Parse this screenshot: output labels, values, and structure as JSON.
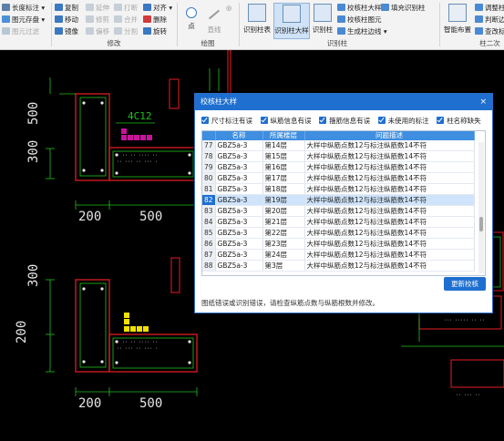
{
  "ribbon": {
    "col1": [
      "长度标注",
      "图元存盘",
      "图元过滤"
    ],
    "col2": [
      "复制",
      "移动",
      "镜像"
    ],
    "col3": [
      "延伸",
      "修剪",
      "偏移"
    ],
    "col4": [
      "打断",
      "合并",
      "分割"
    ],
    "col5": [
      "对齐",
      "删除",
      "旋转"
    ],
    "modify_group": "修改",
    "draw_items": [
      "点",
      "直线"
    ],
    "draw_group": "绘图",
    "recog_buttons": [
      "识别柱表",
      "识别柱大样",
      "识别柱"
    ],
    "recog_small": [
      "校核柱大样",
      "校核柱图元",
      "生成柱边线"
    ],
    "fill_label": "填充识别柱",
    "recog_group": "识别柱",
    "smart_layout": "智能布置",
    "right_items": [
      "调整柱",
      "判断边",
      "查改标"
    ],
    "right_group": "柱二次"
  },
  "canvas": {
    "dims": [
      "200",
      "500",
      "300",
      "200",
      "500",
      "300",
      "200",
      "500"
    ],
    "rebar_label": "4C12"
  },
  "dialog": {
    "title": "校核柱大样",
    "close": "×",
    "filters": [
      "尺寸标注有误",
      "纵筋信息有误",
      "箍筋信息有误",
      "未使用的标注",
      "柱名称缺失"
    ],
    "columns": [
      "",
      "名称",
      "所属楼层",
      "问题描述"
    ],
    "rows": [
      {
        "no": "77",
        "name": "GBZ5a-3",
        "floor": "第14层",
        "desc": "大样中纵筋点数12与标注纵筋数14不符"
      },
      {
        "no": "78",
        "name": "GBZ5a-3",
        "floor": "第15层",
        "desc": "大样中纵筋点数12与标注纵筋数14不符"
      },
      {
        "no": "79",
        "name": "GBZ5a-3",
        "floor": "第16层",
        "desc": "大样中纵筋点数12与标注纵筋数14不符"
      },
      {
        "no": "80",
        "name": "GBZ5a-3",
        "floor": "第17层",
        "desc": "大样中纵筋点数12与标注纵筋数14不符"
      },
      {
        "no": "81",
        "name": "GBZ5a-3",
        "floor": "第18层",
        "desc": "大样中纵筋点数12与标注纵筋数14不符"
      },
      {
        "no": "82",
        "name": "GBZ5a-3",
        "floor": "第19层",
        "desc": "大样中纵筋点数12与标注纵筋数14不符"
      },
      {
        "no": "83",
        "name": "GBZ5a-3",
        "floor": "第20层",
        "desc": "大样中纵筋点数12与标注纵筋数14不符"
      },
      {
        "no": "84",
        "name": "GBZ5a-3",
        "floor": "第21层",
        "desc": "大样中纵筋点数12与标注纵筋数14不符"
      },
      {
        "no": "85",
        "name": "GBZ5a-3",
        "floor": "第22层",
        "desc": "大样中纵筋点数12与标注纵筋数14不符"
      },
      {
        "no": "86",
        "name": "GBZ5a-3",
        "floor": "第23层",
        "desc": "大样中纵筋点数12与标注纵筋数14不符"
      },
      {
        "no": "87",
        "name": "GBZ5a-3",
        "floor": "第24层",
        "desc": "大样中纵筋点数12与标注纵筋数14不符"
      },
      {
        "no": "88",
        "name": "GBZ5a-3",
        "floor": "第3层",
        "desc": "大样中纵筋点数12与标注纵筋数14不符"
      }
    ],
    "selected_index": 5,
    "refresh_label": "更新校核",
    "hint": "图纸错误或识别错误，请检查纵筋点数与纵筋根数并修改。"
  },
  "colors": {
    "accent": "#1f6fd0",
    "cad_red": "#c0181d",
    "cad_green": "#1ec21e",
    "cad_magenta": "#c8139b",
    "cad_yellow": "#f2e000"
  }
}
